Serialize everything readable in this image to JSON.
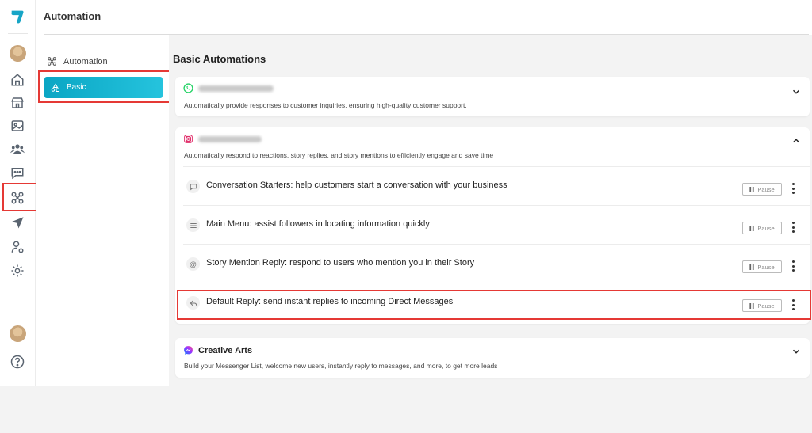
{
  "header": {
    "title": "Automation"
  },
  "rail": {
    "icons": [
      "logo-icon",
      "avatar",
      "home-icon",
      "store-icon",
      "image-icon",
      "users-icon",
      "chat-icon",
      "automation-icon",
      "send-icon",
      "user-settings-icon",
      "gear-icon",
      "help-icon"
    ],
    "active": "automation-icon"
  },
  "subnav": {
    "section_label": "Automation",
    "active_label": "Basic"
  },
  "main": {
    "heading": "Basic Automations",
    "cards": [
      {
        "platform_icon": "whatsapp-icon",
        "name_redacted": true,
        "description": "Automatically provide responses to customer inquiries, ensuring high-quality customer support.",
        "expanded": false
      },
      {
        "platform_icon": "instagram-icon",
        "name_redacted": true,
        "description": "Automatically respond to reactions, story replies, and story mentions to efficiently engage and save time",
        "expanded": true,
        "rows": [
          {
            "icon": "chat-bubble-icon",
            "label": "Conversation Starters: help customers start a conversation with your business",
            "action": "Pause"
          },
          {
            "icon": "menu-icon",
            "label": "Main Menu: assist followers in locating information quickly",
            "action": "Pause"
          },
          {
            "icon": "at-icon",
            "label": "Story Mention Reply: respond to users who mention you in their Story",
            "action": "Pause"
          },
          {
            "icon": "reply-icon",
            "label": "Default Reply: send instant replies to incoming Direct Messages",
            "action": "Pause"
          }
        ]
      },
      {
        "platform_icon": "messenger-icon",
        "name": "Creative Arts",
        "description": "Build your Messenger List, welcome new users, instantly reply to messages, and more, to get more leads",
        "expanded": false
      }
    ]
  },
  "colors": {
    "accent": "#0aa6c4",
    "highlight": "#e53935",
    "whatsapp": "#25d366",
    "instagram": "#e1306c",
    "messenger": "#7b5cff"
  }
}
